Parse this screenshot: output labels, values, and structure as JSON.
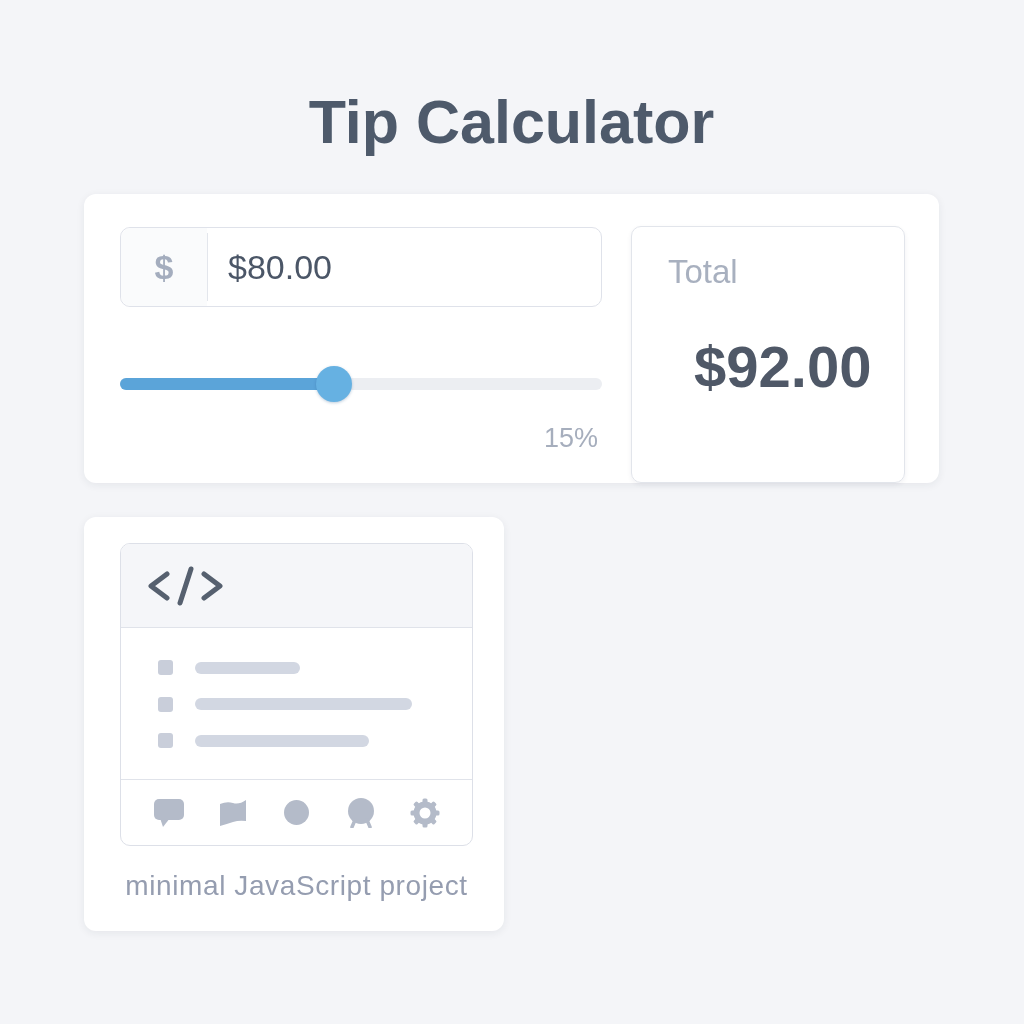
{
  "title": "Tip Calculator",
  "calculator": {
    "bill": {
      "currency_symbol": "$",
      "value": "$80.00"
    },
    "tip_slider": {
      "level": 0.444,
      "reading": "15%"
    },
    "total": {
      "label": "Total",
      "value": "$92.00"
    }
  },
  "project": {
    "caption": "minimal JavaScript project"
  }
}
